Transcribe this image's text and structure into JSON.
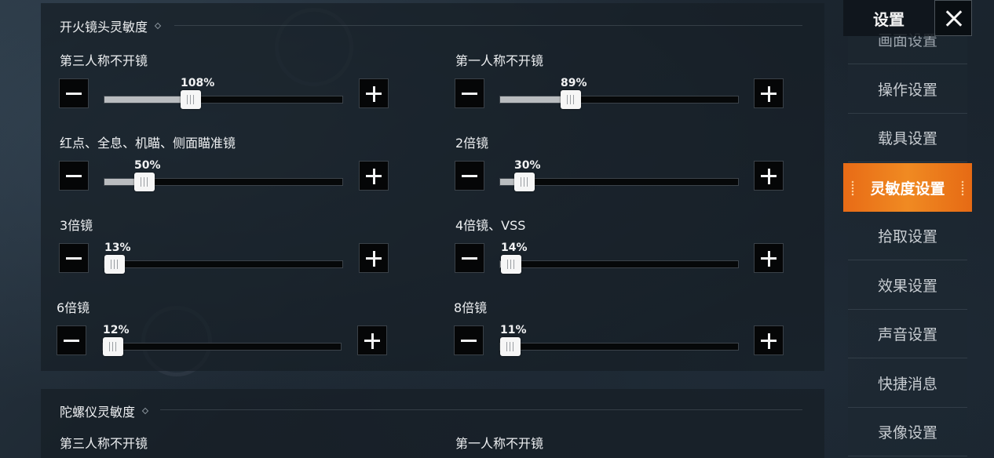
{
  "header": {
    "title": "设置"
  },
  "fire_section": {
    "title": "开火镜头灵敏度",
    "sliders": [
      {
        "label": "第三人称不开镜",
        "value": 108,
        "max": 300,
        "display": "108%"
      },
      {
        "label": "第一人称不开镜",
        "value": 89,
        "max": 300,
        "display": "89%"
      },
      {
        "label": "红点、全息、机瞄、侧面瞄准镜",
        "value": 50,
        "max": 300,
        "display": "50%"
      },
      {
        "label": "2倍镜",
        "value": 30,
        "max": 300,
        "display": "30%"
      },
      {
        "label": "3倍镜",
        "value": 13,
        "max": 300,
        "display": "13%"
      },
      {
        "label": "4倍镜、VSS",
        "value": 14,
        "max": 300,
        "display": "14%"
      },
      {
        "label": "6倍镜",
        "value": 12,
        "max": 300,
        "display": "12%"
      },
      {
        "label": "8倍镜",
        "value": 11,
        "max": 300,
        "display": "11%"
      }
    ]
  },
  "gyro_section": {
    "title": "陀螺仪灵敏度",
    "partial_labels": [
      "第三人称不开镜",
      "第一人称不开镜"
    ]
  },
  "menu": {
    "items": [
      {
        "label": "画面设置",
        "active": false
      },
      {
        "label": "操作设置",
        "active": false
      },
      {
        "label": "载具设置",
        "active": false
      },
      {
        "label": "灵敏度设置",
        "active": true
      },
      {
        "label": "拾取设置",
        "active": false
      },
      {
        "label": "效果设置",
        "active": false
      },
      {
        "label": "声音设置",
        "active": false
      },
      {
        "label": "快捷消息",
        "active": false
      },
      {
        "label": "录像设置",
        "active": false
      }
    ]
  },
  "colors": {
    "accent": "#f08a22",
    "panel": "#161e26",
    "button": "#050607"
  },
  "icons": {
    "decrease": "minus-icon",
    "increase": "plus-icon",
    "close": "close-icon"
  }
}
